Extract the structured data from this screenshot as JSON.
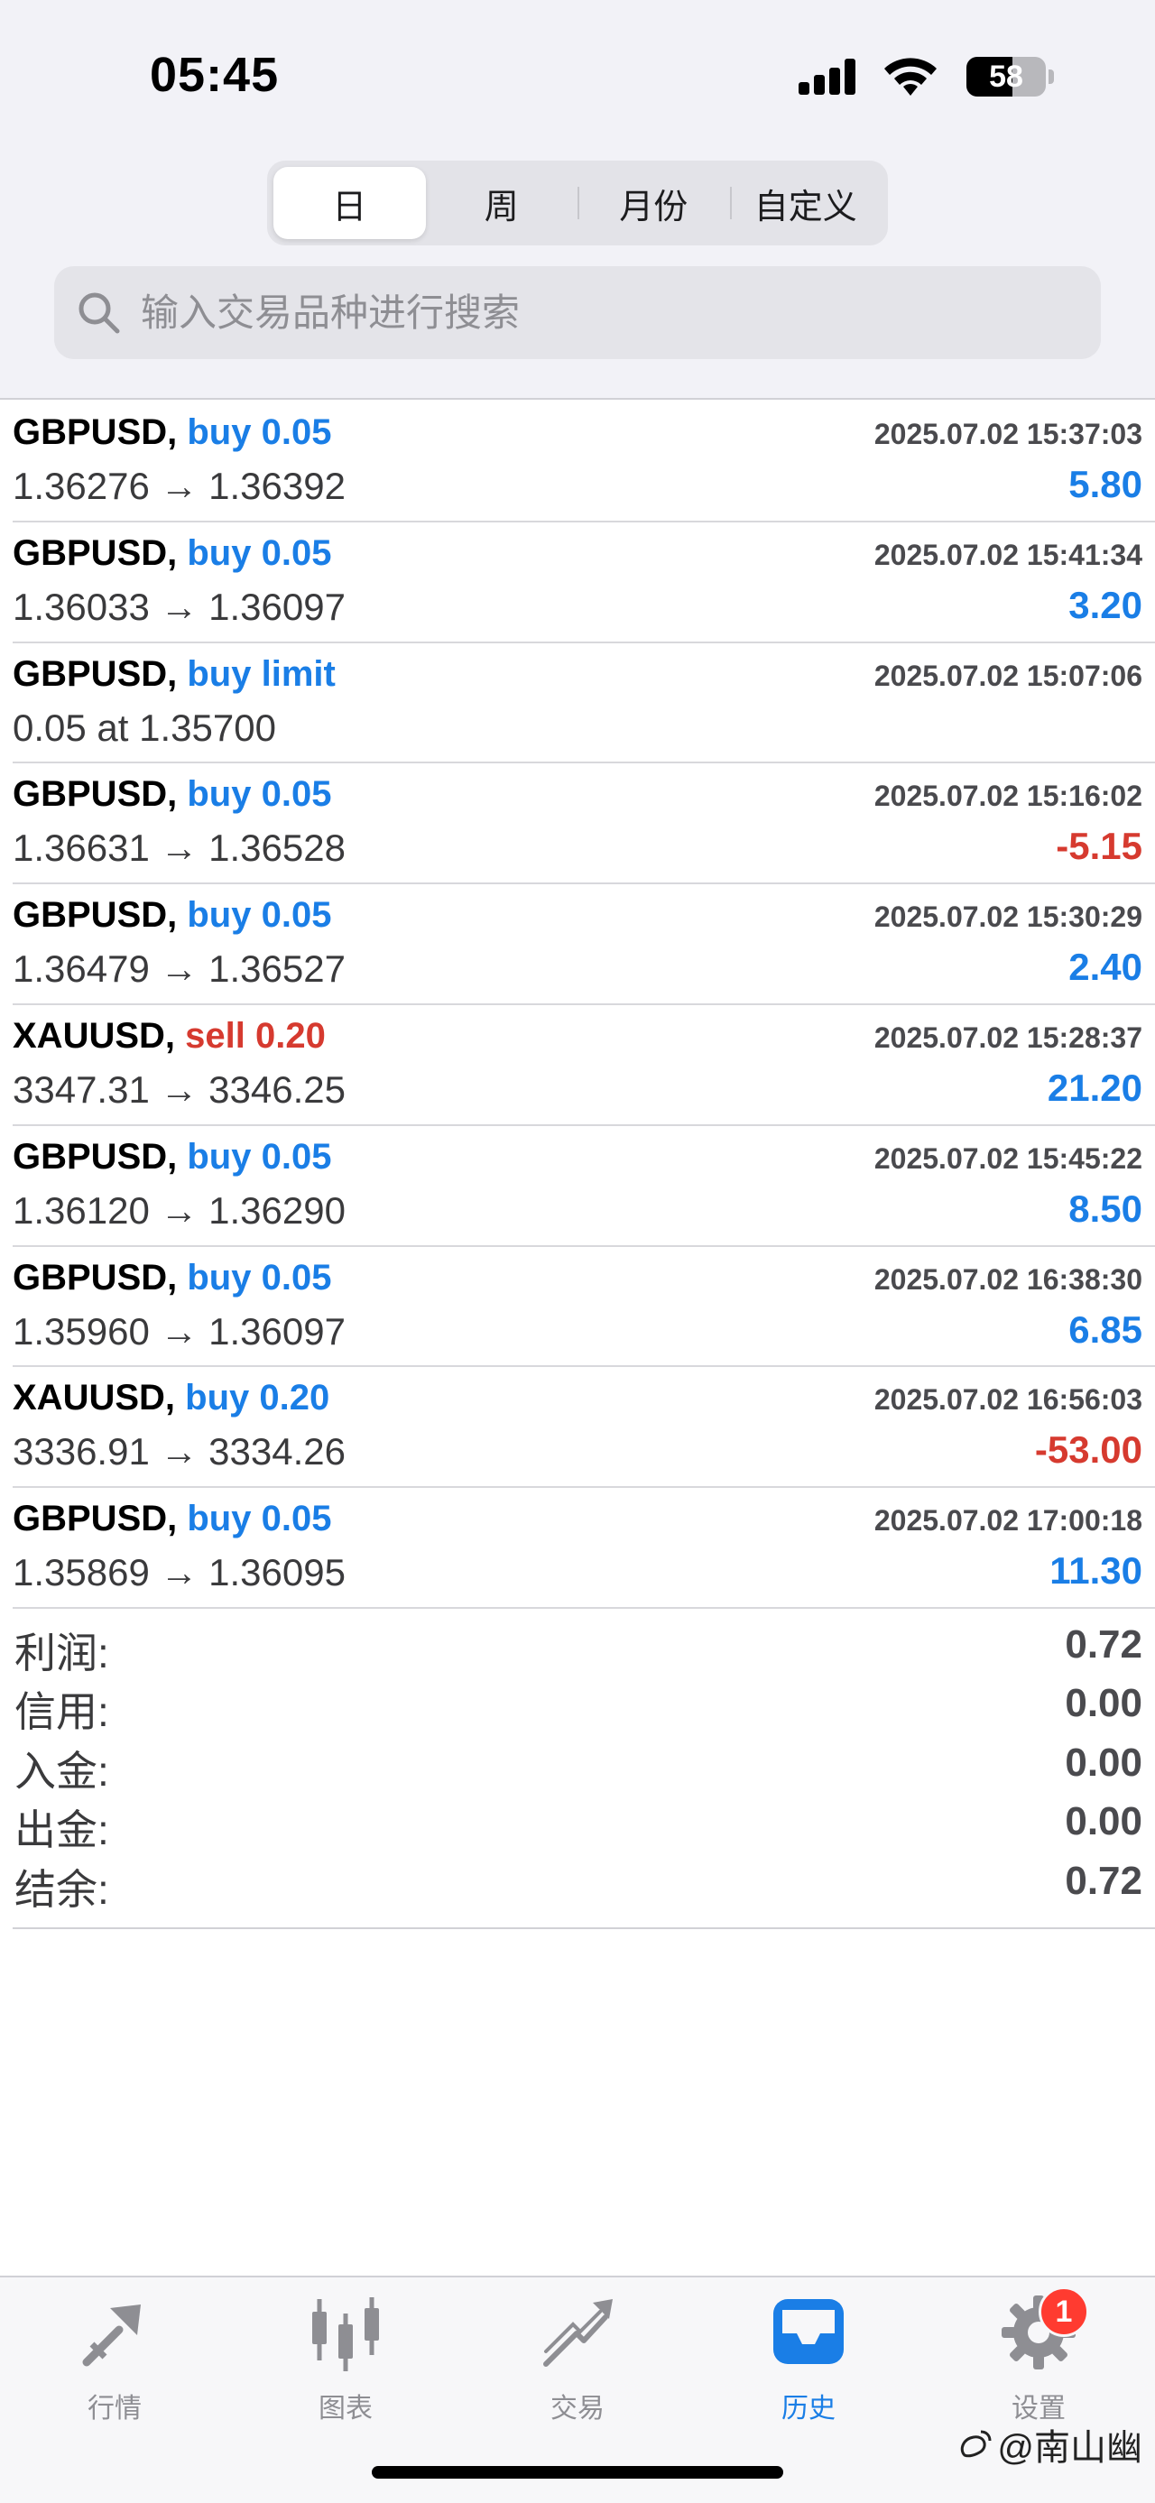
{
  "status_bar": {
    "time": "05:45",
    "battery": "58"
  },
  "segments": [
    {
      "label": "日",
      "active": true
    },
    {
      "label": "周",
      "active": false
    },
    {
      "label": "月份",
      "active": false
    },
    {
      "label": "自定义",
      "active": false
    }
  ],
  "search": {
    "placeholder": "输入交易品种进行搜索",
    "value": ""
  },
  "trades": [
    {
      "symbol": "GBPUSD,",
      "direction": "buy 0.05",
      "side": "buy",
      "time": "2025.07.02 15:37:03",
      "prices": "1.36276 → 1.36392",
      "profit": "5.80",
      "negative": false
    },
    {
      "symbol": "GBPUSD,",
      "direction": "buy 0.05",
      "side": "buy",
      "time": "2025.07.02 15:41:34",
      "prices": "1.36033 → 1.36097",
      "profit": "3.20",
      "negative": false
    },
    {
      "symbol": "GBPUSD,",
      "direction": "buy limit",
      "side": "buy",
      "time": "2025.07.02 15:07:06",
      "prices": "0.05 at 1.35700",
      "profit": "",
      "negative": false
    },
    {
      "symbol": "GBPUSD,",
      "direction": "buy 0.05",
      "side": "buy",
      "time": "2025.07.02 15:16:02",
      "prices": "1.36631 → 1.36528",
      "profit": "-5.15",
      "negative": true
    },
    {
      "symbol": "GBPUSD,",
      "direction": "buy 0.05",
      "side": "buy",
      "time": "2025.07.02 15:30:29",
      "prices": "1.36479 → 1.36527",
      "profit": "2.40",
      "negative": false
    },
    {
      "symbol": "XAUUSD,",
      "direction": "sell 0.20",
      "side": "sell",
      "time": "2025.07.02 15:28:37",
      "prices": "3347.31 → 3346.25",
      "profit": "21.20",
      "negative": false
    },
    {
      "symbol": "GBPUSD,",
      "direction": "buy 0.05",
      "side": "buy",
      "time": "2025.07.02 15:45:22",
      "prices": "1.36120 → 1.36290",
      "profit": "8.50",
      "negative": false
    },
    {
      "symbol": "GBPUSD,",
      "direction": "buy 0.05",
      "side": "buy",
      "time": "2025.07.02 16:38:30",
      "prices": "1.35960 → 1.36097",
      "profit": "6.85",
      "negative": false
    },
    {
      "symbol": "XAUUSD,",
      "direction": "buy 0.20",
      "side": "buy",
      "time": "2025.07.02 16:56:03",
      "prices": "3336.91 → 3334.26",
      "profit": "-53.00",
      "negative": true
    },
    {
      "symbol": "GBPUSD,",
      "direction": "buy 0.05",
      "side": "buy",
      "time": "2025.07.02 17:00:18",
      "prices": "1.35869 → 1.36095",
      "profit": "11.30",
      "negative": false
    }
  ],
  "summary": [
    {
      "label": "利润:",
      "value": "0.72"
    },
    {
      "label": "信用:",
      "value": "0.00"
    },
    {
      "label": "入金:",
      "value": "0.00"
    },
    {
      "label": "出金:",
      "value": "0.00"
    },
    {
      "label": "结余:",
      "value": "0.72"
    }
  ],
  "tabs": [
    {
      "label": "行情",
      "icon": "quotes-icon",
      "active": false
    },
    {
      "label": "图表",
      "icon": "chart-candles-icon",
      "active": false
    },
    {
      "label": "交易",
      "icon": "trade-icon",
      "active": false
    },
    {
      "label": "历史",
      "icon": "history-inbox-icon",
      "active": true
    },
    {
      "label": "设置",
      "icon": "gear-icon",
      "active": false,
      "badge": "1"
    }
  ],
  "watermark": "@南山幽",
  "colors": {
    "accent": "#1a7ee6",
    "negative": "#d63a2f",
    "badge": "#ff3b30",
    "inactive": "#8e8e93"
  }
}
